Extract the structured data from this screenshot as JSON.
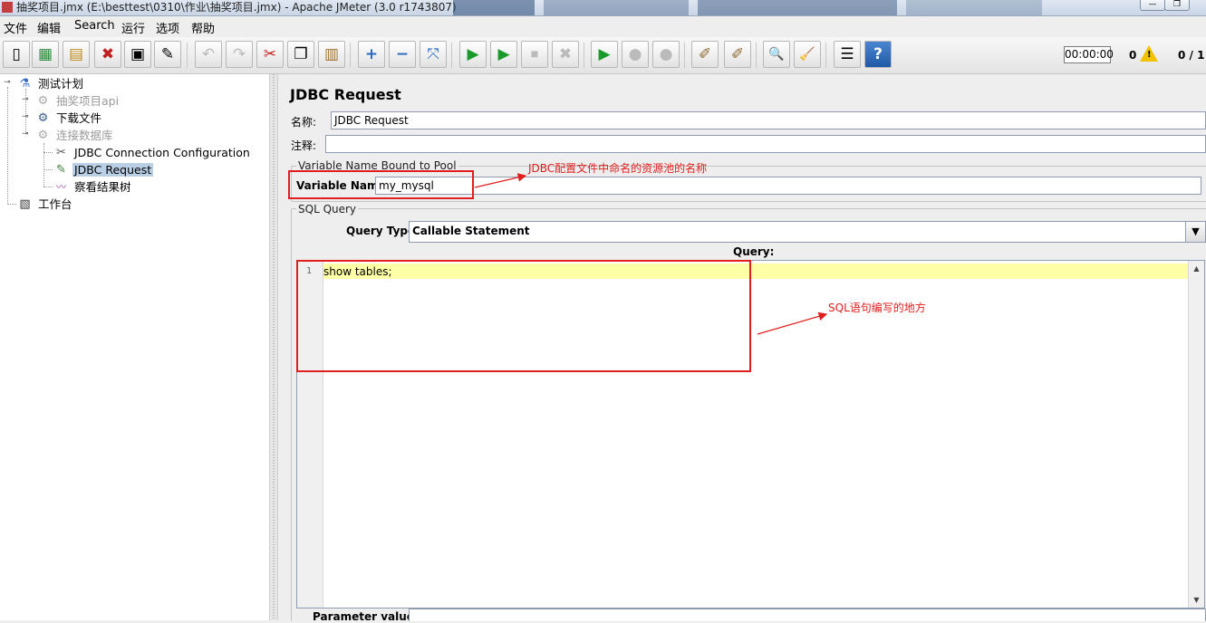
{
  "window": {
    "title": "抽奖项目.jmx (E:\\besttest\\0310\\作业\\抽奖项目.jmx) - Apache JMeter (3.0 r1743807)",
    "minimize_label": "—",
    "maximize_label": "❐"
  },
  "menu": [
    "文件",
    "编辑",
    "Search",
    "运行",
    "选项",
    "帮助"
  ],
  "toolbar": {
    "buttons": [
      {
        "icon": "new-icon",
        "glyph": "▯"
      },
      {
        "icon": "templates-icon",
        "glyph": "▦"
      },
      {
        "icon": "open-icon",
        "glyph": "▤"
      },
      {
        "icon": "close-file-icon",
        "glyph": "✖"
      },
      {
        "icon": "save-icon",
        "glyph": "▣"
      },
      {
        "icon": "save-as-icon",
        "glyph": "✎"
      },
      {
        "icon": "undo-icon",
        "glyph": "↶"
      },
      {
        "icon": "redo-icon",
        "glyph": "↷"
      },
      {
        "icon": "cut-icon",
        "glyph": "✂"
      },
      {
        "icon": "copy-icon",
        "glyph": "❐"
      },
      {
        "icon": "paste-icon",
        "glyph": "▥"
      },
      {
        "icon": "expand-icon",
        "glyph": "+"
      },
      {
        "icon": "collapse-icon",
        "glyph": "−"
      },
      {
        "icon": "toggle-icon",
        "glyph": "⤧"
      },
      {
        "icon": "start-icon",
        "glyph": "▶"
      },
      {
        "icon": "start-no-pause-icon",
        "glyph": "▶"
      },
      {
        "icon": "stop-icon",
        "glyph": "⏹"
      },
      {
        "icon": "shutdown-icon",
        "glyph": "✖"
      },
      {
        "icon": "remote-start-icon",
        "glyph": "▶"
      },
      {
        "icon": "remote-stop-icon",
        "glyph": "●"
      },
      {
        "icon": "remote-shutdown-icon",
        "glyph": "●"
      },
      {
        "icon": "clear-icon",
        "glyph": "✐"
      },
      {
        "icon": "clear-all-icon",
        "glyph": "✐"
      },
      {
        "icon": "search-icon",
        "glyph": "🔍"
      },
      {
        "icon": "reset-search-icon",
        "glyph": "🧹"
      },
      {
        "icon": "function-helper-icon",
        "glyph": "☰"
      },
      {
        "icon": "help-icon",
        "glyph": "?"
      }
    ],
    "timer": "00:00:00",
    "warning_count": "0",
    "threads": "0 / 1"
  },
  "tree": {
    "nodes": [
      {
        "label": "测试计划",
        "icon": "test-plan-icon",
        "glyph": "⚗",
        "disabled": false
      },
      {
        "label": "抽奖项目api",
        "icon": "thread-group-icon",
        "glyph": "⚙",
        "disabled": true
      },
      {
        "label": "下载文件",
        "icon": "thread-group-icon",
        "glyph": "⚙",
        "disabled": false
      },
      {
        "label": "连接数据库",
        "icon": "thread-group-icon",
        "glyph": "⚙",
        "disabled": true
      },
      {
        "label": "JDBC Connection Configuration",
        "icon": "config-element-icon",
        "glyph": "✂",
        "disabled": false
      },
      {
        "label": "JDBC Request",
        "icon": "sampler-icon",
        "glyph": "✎",
        "disabled": false
      },
      {
        "label": "察看结果树",
        "icon": "listener-icon",
        "glyph": "〰",
        "disabled": false
      },
      {
        "label": "工作台",
        "icon": "workbench-icon",
        "glyph": "▧",
        "disabled": false
      }
    ]
  },
  "panel": {
    "title": "JDBC Request",
    "name_label": "名称:",
    "name_value": "JDBC Request",
    "comment_label": "注释:",
    "comment_value": "",
    "pool_group_title": "Variable Name Bound to Pool",
    "variable_name_label": "Variable Name:",
    "variable_name_value": "my_mysql",
    "sql_group_title": "SQL Query",
    "query_type_label": "Query Type:",
    "query_type_value": "Callable Statement",
    "query_label": "Query:",
    "line_number": "1",
    "query_text": "show tables;",
    "parameter_values_label": "Parameter values:"
  },
  "annotations": {
    "pool_note": "JDBC配置文件中命名的资源池的名称",
    "sql_note": "SQL语句编写的地方",
    "color": "#e01e1e"
  }
}
